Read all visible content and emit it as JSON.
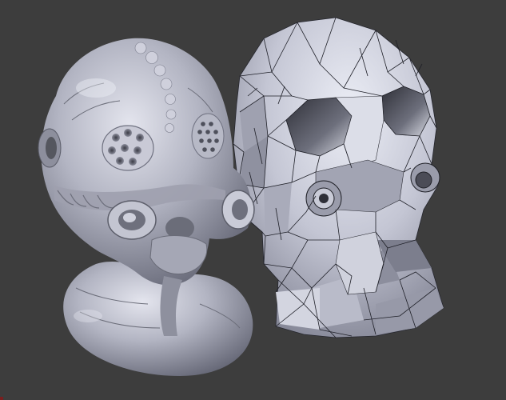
{
  "viewport": {
    "background": "#3d3d3d",
    "objects": [
      {
        "name": "sculpted-high-poly-head",
        "shading": "smooth",
        "color": "#b4b6c4"
      },
      {
        "name": "retopology-low-poly-head",
        "shading": "flat-wireframe",
        "color": "#c2c4d2"
      }
    ]
  }
}
